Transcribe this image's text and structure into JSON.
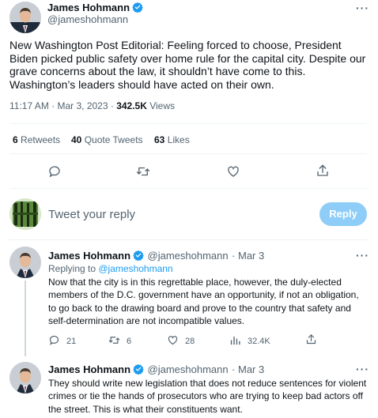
{
  "main_tweet": {
    "author_name": "James Hohmann",
    "author_handle": "@jameshohmann",
    "text": "New Washington Post Editorial: Feeling forced to choose, President Biden picked public safety over home rule for the capital city. Despite our grave concerns about the law, it shouldn’t have come to this. Washington’s leaders should have acted on their own.",
    "time": "11:17 AM · Mar 3, 2023 · ",
    "views_count": "342.5K",
    "views_label": " Views",
    "stats": {
      "retweets_count": "6",
      "retweets_label": "Retweets",
      "quotes_count": "40",
      "quotes_label": "Quote Tweets",
      "likes_count": "63",
      "likes_label": "Likes"
    }
  },
  "composer": {
    "placeholder": "Tweet your reply",
    "button_label": "Reply"
  },
  "replies": [
    {
      "author_name": "James Hohmann",
      "author_handle": "@jameshohmann",
      "date": "· Mar 3",
      "replying_prefix": "Replying to ",
      "replying_handle": "@jameshohmann",
      "text": "Now that the city is in this regrettable place, however, the duly-elected members of the D.C. government have an opportunity, if not an obligation, to go back to the drawing board and prove to the country that safety and self-determination are not incompatible values.",
      "replies_count": "21",
      "retweets_count": "6",
      "likes_count": "28",
      "views_count": "32.4K"
    },
    {
      "author_name": "James Hohmann",
      "author_handle": "@jameshohmann",
      "date": "· Mar 3",
      "text": "They should write new legislation that does not reduce sentences for violent crimes or tie the hands of prosecutors who are trying to keep bad actors off the street. This is what their constituents want."
    }
  ],
  "colors": {
    "accent": "#1d9bf0",
    "muted": "#536471",
    "reply_button": "#8ecdf7"
  },
  "icons": [
    "verified-badge-icon",
    "more-icon",
    "reply-icon",
    "retweet-icon",
    "like-icon",
    "share-icon",
    "views-icon"
  ]
}
